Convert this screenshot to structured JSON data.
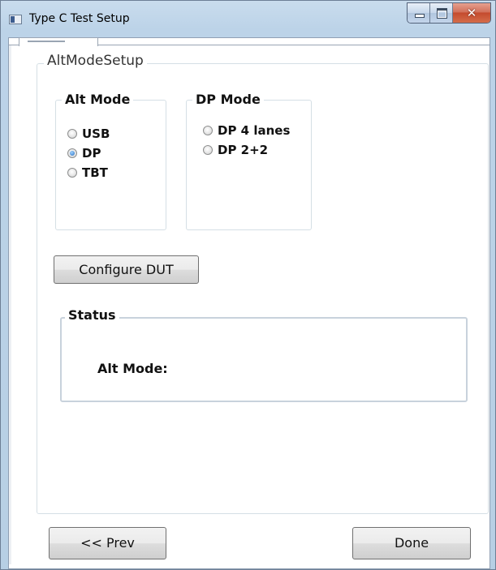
{
  "window": {
    "title": "Type C Test Setup",
    "close_glyph": "✕"
  },
  "panel": {
    "title": "AltModeSetup"
  },
  "alt_mode": {
    "title": "Alt Mode",
    "options": [
      {
        "label": "USB",
        "checked": false
      },
      {
        "label": "DP",
        "checked": true
      },
      {
        "label": "TBT",
        "checked": false
      }
    ]
  },
  "dp_mode": {
    "title": "DP Mode",
    "options": [
      {
        "label": "DP 4 lanes",
        "checked": false
      },
      {
        "label": "DP 2+2",
        "checked": false
      }
    ]
  },
  "configure_button": {
    "label": "Configure DUT"
  },
  "status": {
    "title": "Status",
    "alt_mode_label": "Alt Mode:"
  },
  "nav": {
    "prev_label": "<< Prev",
    "done_label": "Done"
  },
  "icons": {
    "app": "window-app-icon",
    "minimize": "minimize-icon",
    "maximize": "maximize-icon",
    "close": "close-icon"
  },
  "colors": {
    "title_bar": "#bcd3e8",
    "close_button": "#c44b2e",
    "radio_selected": "#2a6fc0",
    "frame_border": "#d5dfe5"
  }
}
